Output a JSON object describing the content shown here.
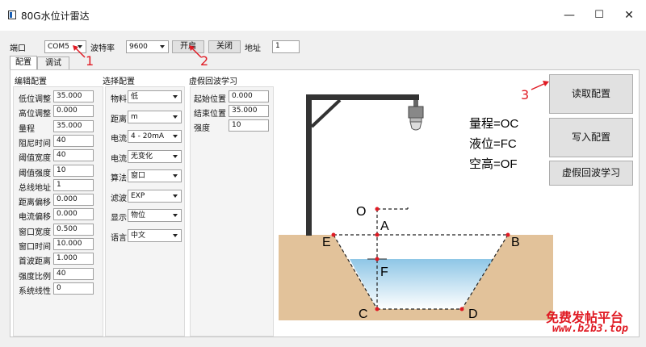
{
  "window": {
    "title": "80G水位计雷达",
    "minimize": "—",
    "maximize": "☐",
    "close": "✕"
  },
  "toolbar": {
    "port_label": "端口",
    "port_value": "COM5",
    "baud_label": "波特率",
    "baud_value": "9600",
    "open_label": "开启",
    "close_label": "关闭",
    "addr_label": "地址",
    "addr_value": "1"
  },
  "tabs": [
    {
      "label": "配置"
    },
    {
      "label": "调试"
    }
  ],
  "edit_config": {
    "title": "编辑配置",
    "fields": [
      {
        "label": "低位调整",
        "value": "35.000"
      },
      {
        "label": "高位调整",
        "value": "0.000"
      },
      {
        "label": "量程",
        "value": "35.000"
      },
      {
        "label": "阻尼时间",
        "value": "40"
      },
      {
        "label": "阈值宽度",
        "value": "40"
      },
      {
        "label": "阈值强度",
        "value": "10"
      },
      {
        "label": "总线地址",
        "value": "1"
      },
      {
        "label": "距离偏移",
        "value": "0.000"
      },
      {
        "label": "电流偏移",
        "value": "0.000"
      },
      {
        "label": "窗口宽度",
        "value": "0.500"
      },
      {
        "label": "窗口时间",
        "value": "10.000"
      },
      {
        "label": "首波距离",
        "value": "1.000"
      },
      {
        "label": "强度比例",
        "value": "40"
      },
      {
        "label": "系统线性",
        "value": "0"
      }
    ]
  },
  "select_config": {
    "title": "选择配置",
    "fields": [
      {
        "label": "物料",
        "value": "低"
      },
      {
        "label": "距离",
        "value": "m"
      },
      {
        "label": "电流",
        "value": "4 - 20mA"
      },
      {
        "label": "电流",
        "value": "无变化"
      },
      {
        "label": "算法",
        "value": "窗口"
      },
      {
        "label": "滤波",
        "value": "EXP"
      },
      {
        "label": "显示",
        "value": "物位"
      },
      {
        "label": "语言",
        "value": "中文"
      }
    ]
  },
  "false_echo": {
    "title": "虚假回波学习",
    "fields": [
      {
        "label": "起始位置",
        "value": "0.000"
      },
      {
        "label": "结束位置",
        "value": "35.000"
      },
      {
        "label": "强度",
        "value": "10"
      }
    ]
  },
  "diagram": {
    "labels": {
      "O": "O",
      "A": "A",
      "B": "B",
      "C": "C",
      "D": "D",
      "E": "E",
      "F": "F"
    },
    "legend": [
      "量程=OC",
      "液位=FC",
      "空高=OF"
    ]
  },
  "buttons": {
    "read": "读取配置",
    "write": "写入配置",
    "learn": "虚假回波学习"
  },
  "annotations": {
    "one": "1",
    "two": "2",
    "three": "3"
  },
  "watermark": {
    "line1": "免费发帖平台",
    "line2": "www.b2b3.top"
  },
  "colors": {
    "annotation": "#e01b24",
    "soil": "#e2c29a",
    "water_top": "#8ec6e6",
    "water_bottom": "#ffffff"
  }
}
